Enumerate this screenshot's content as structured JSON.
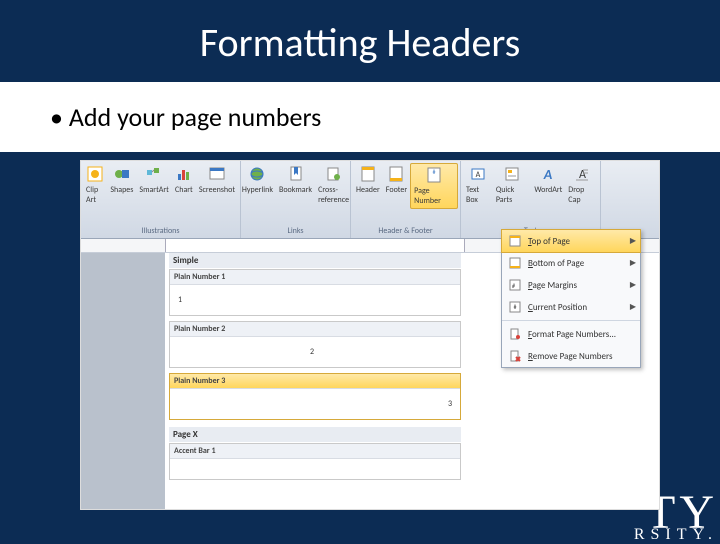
{
  "slide": {
    "title": "Formatting Headers",
    "bullet": "Add your page numbers"
  },
  "ribbon": {
    "groups": {
      "illustrations": {
        "label": "Illustrations",
        "clipart": "Clip Art",
        "shapes": "Shapes",
        "smartart": "SmartArt",
        "chart": "Chart",
        "screenshot": "Screenshot"
      },
      "links": {
        "label": "Links",
        "hyperlink": "Hyperlink",
        "bookmark": "Bookmark",
        "crossref": "Cross-reference"
      },
      "headerfooter": {
        "label": "Header & Footer",
        "header": "Header",
        "footer": "Footer",
        "pagenum": "Page Number"
      },
      "text": {
        "label": "Text",
        "textbox": "Text Box",
        "quickparts": "Quick Parts",
        "wordart": "WordArt",
        "dropcap": "Drop Cap"
      }
    }
  },
  "dropdown": {
    "top": "Top of Page",
    "bottom": "Bottom of Page",
    "margins": "Page Margins",
    "current": "Current Position",
    "format": "Format Page Numbers...",
    "remove": "Remove Page Numbers"
  },
  "gallery": {
    "title": "Simple",
    "items": {
      "p1": "Plain Number 1",
      "p2": "Plain Number 2",
      "p3": "Plain Number 3",
      "pagex": "Page X",
      "accent": "Accent Bar 1"
    }
  },
  "watermark": {
    "big": "TY",
    "small": "RSITY."
  }
}
